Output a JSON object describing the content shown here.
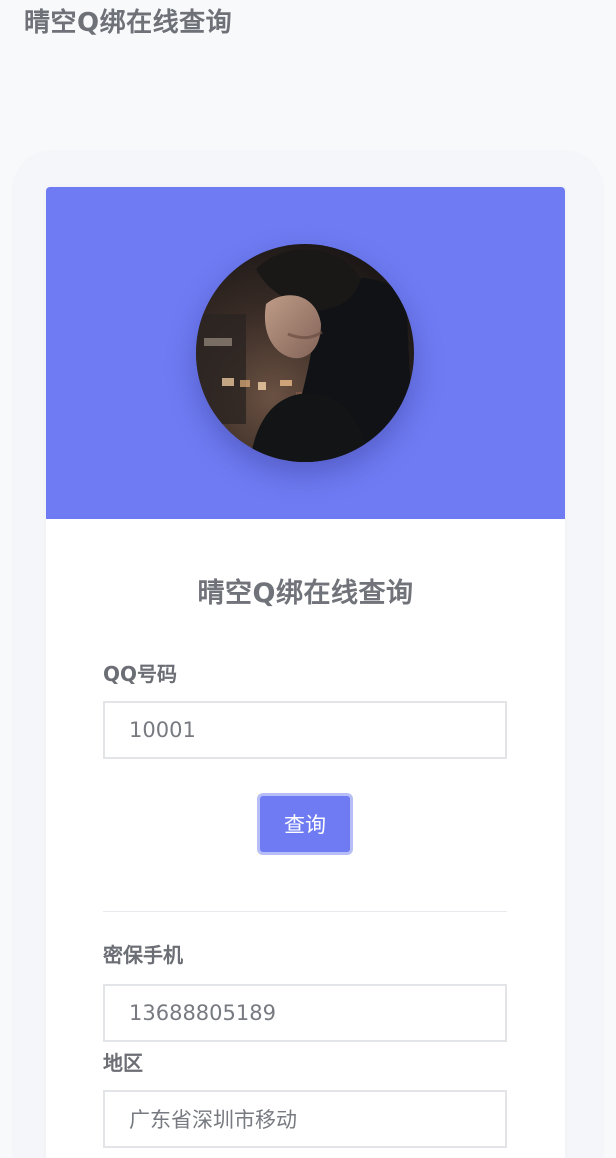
{
  "app": {
    "title": "晴空Q绑在线查询"
  },
  "form": {
    "title": "晴空Q绑在线查询",
    "qq": {
      "label": "QQ号码",
      "value": "10001"
    },
    "query_button": "查询"
  },
  "result": {
    "phone": {
      "label": "密保手机",
      "value": "13688805189"
    },
    "region": {
      "label": "地区",
      "value": "广东省深圳市移动"
    }
  },
  "colors": {
    "accent": "#6e7bf2",
    "background": "#f8f9fb",
    "card": "#ffffff"
  }
}
